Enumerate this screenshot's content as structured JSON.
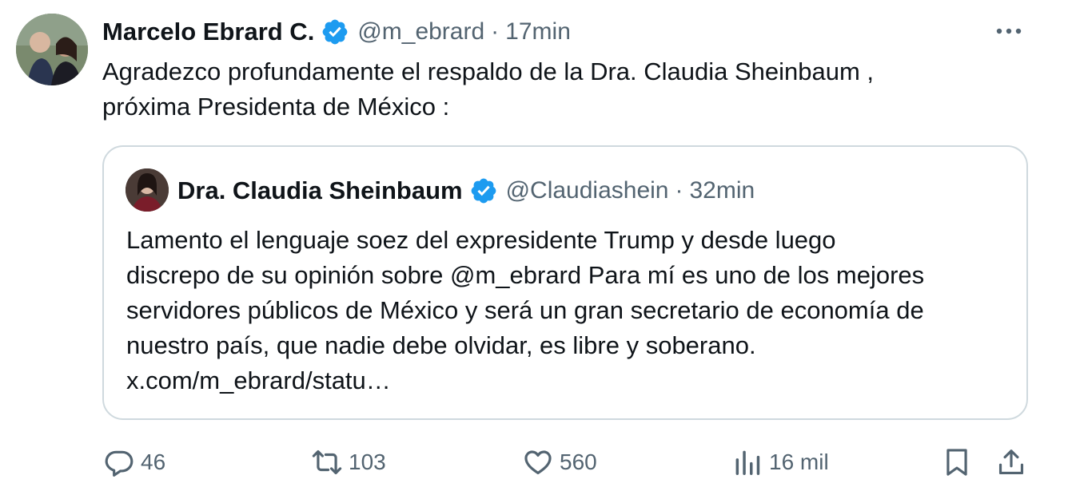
{
  "author": {
    "name": "Marcelo Ebrard C.",
    "handle": "@m_ebrard",
    "separator": "·",
    "time": "17min"
  },
  "tweet": {
    "text_line1": "Agradezco profundamente el respaldo de la Dra. Claudia Sheinbaum ,",
    "text_line2": "próxima Presidenta de México :"
  },
  "quote": {
    "name": "Dra. Claudia Sheinbaum",
    "handle": "@Claudiashein",
    "separator": "·",
    "time": "32min",
    "lines": [
      "Lamento el lenguaje soez del expresidente Trump y desde luego",
      "discrepo de su opinión sobre @m_ebrard Para mí es uno de los mejores",
      "servidores públicos de México y será un gran secretario de economía de",
      "nuestro país, que nadie debe olvidar, es libre y soberano.",
      "x.com/m_ebrard/statu…"
    ]
  },
  "actions": {
    "replies": "46",
    "retweets": "103",
    "likes": "560",
    "views": "16 mil"
  },
  "icons": {
    "verified": "verified-badge-icon",
    "more": "more-icon",
    "reply": "reply-icon",
    "retweet": "retweet-icon",
    "like": "heart-icon",
    "views": "views-icon",
    "bookmark": "bookmark-icon",
    "share": "share-icon"
  },
  "colors": {
    "text": "#0f1419",
    "secondary": "#536471",
    "verified": "#1d9bf0",
    "border": "#cfd9de"
  }
}
